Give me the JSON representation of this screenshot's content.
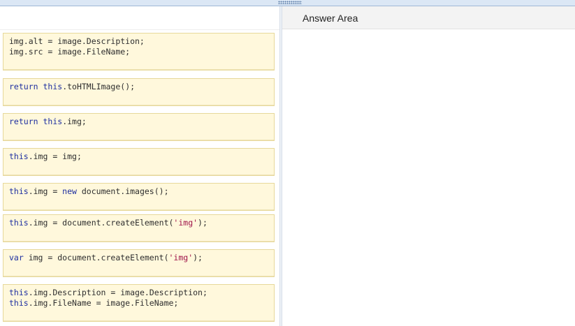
{
  "answer_area": {
    "title": "Answer Area"
  },
  "tiles": [
    {
      "lines": [
        [
          {
            "t": "img.alt = image.Description;",
            "c": ""
          }
        ],
        [
          {
            "t": "img.src = image.FileName;",
            "c": ""
          }
        ]
      ]
    },
    {
      "lines": [
        [
          {
            "t": "return",
            "c": "kw"
          },
          {
            "t": " ",
            "c": ""
          },
          {
            "t": "this",
            "c": "kw"
          },
          {
            "t": ".toHTMLImage();",
            "c": ""
          }
        ]
      ]
    },
    {
      "lines": [
        [
          {
            "t": "return",
            "c": "kw"
          },
          {
            "t": " ",
            "c": ""
          },
          {
            "t": "this",
            "c": "kw"
          },
          {
            "t": ".img;",
            "c": ""
          }
        ]
      ]
    },
    {
      "lines": [
        [
          {
            "t": "this",
            "c": "kw"
          },
          {
            "t": ".img = img;",
            "c": ""
          }
        ]
      ]
    },
    {
      "lines": [
        [
          {
            "t": "this",
            "c": "kw"
          },
          {
            "t": ".img = ",
            "c": ""
          },
          {
            "t": "new",
            "c": "kw"
          },
          {
            "t": " document.images();",
            "c": ""
          }
        ]
      ]
    },
    {
      "lines": [
        [
          {
            "t": "this",
            "c": "kw"
          },
          {
            "t": ".img = document.createElement(",
            "c": ""
          },
          {
            "t": "'img'",
            "c": "str"
          },
          {
            "t": ");",
            "c": ""
          }
        ]
      ]
    },
    {
      "lines": [
        [
          {
            "t": "var",
            "c": "kw"
          },
          {
            "t": " img = document.createElement(",
            "c": ""
          },
          {
            "t": "'img'",
            "c": "str"
          },
          {
            "t": ");",
            "c": ""
          }
        ]
      ]
    },
    {
      "lines": [
        [
          {
            "t": "this",
            "c": "kw"
          },
          {
            "t": ".img.Description = image.Description;",
            "c": ""
          }
        ],
        [
          {
            "t": "this",
            "c": "kw"
          },
          {
            "t": ".img.FileName = image.FileName;",
            "c": ""
          }
        ]
      ]
    }
  ]
}
